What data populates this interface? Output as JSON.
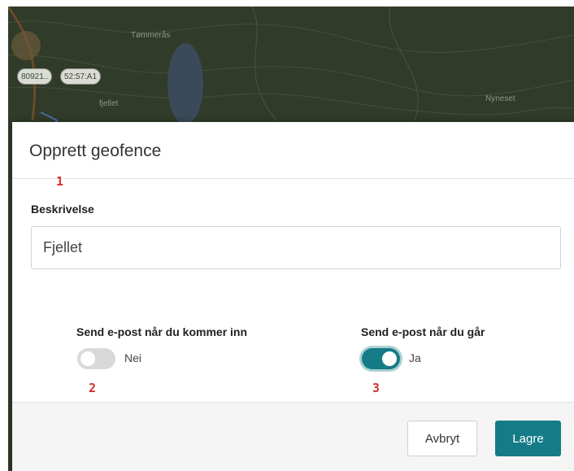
{
  "map": {
    "labels": {
      "place_top": "Tømmerås",
      "place_left": "fjellet",
      "place_right": "Nyneset"
    },
    "pills": {
      "pill_1": "80921..",
      "pill_2": "52:57:A1"
    }
  },
  "modal": {
    "title": "Opprett geofence",
    "markers": {
      "m1": "1",
      "m2": "2",
      "m3": "3"
    },
    "description": {
      "label": "Beskrivelse",
      "value": "Fjellet"
    },
    "toggle_enter": {
      "label": "Send e-post når du kommer inn",
      "state_text": "Nei",
      "checked": false
    },
    "toggle_exit": {
      "label": "Send e-post når du går",
      "state_text": "Ja",
      "checked": true
    },
    "buttons": {
      "cancel": "Avbryt",
      "save": "Lagre"
    }
  },
  "colors": {
    "accent": "#147c87",
    "marker_red": "#d32f2f",
    "footer_bg": "#f5f5f5"
  }
}
